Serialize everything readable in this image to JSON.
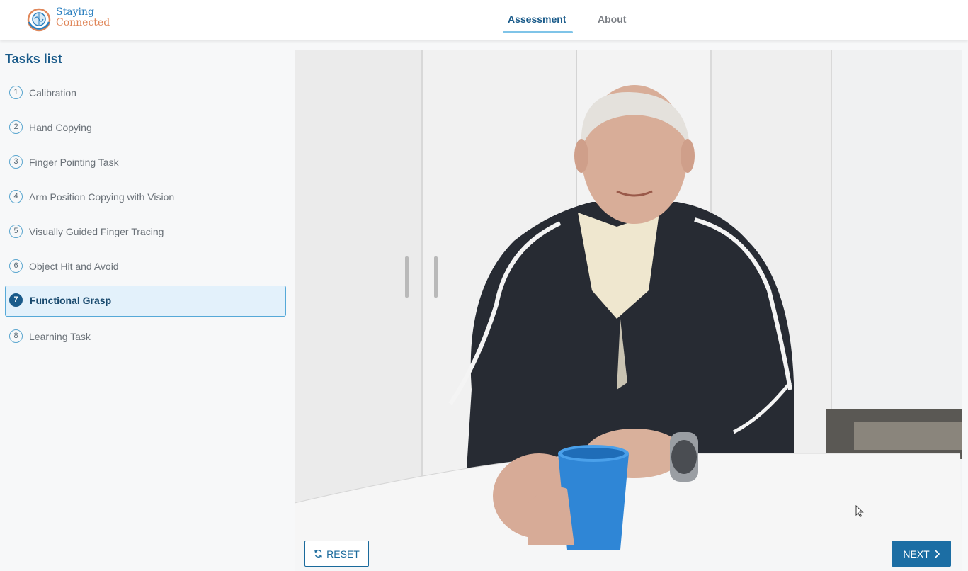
{
  "header": {
    "logo": {
      "line1": "Staying",
      "line2": "Connected"
    },
    "nav": [
      {
        "label": "Assessment",
        "active": true
      },
      {
        "label": "About",
        "active": false
      }
    ]
  },
  "sidebar": {
    "title": "Tasks list",
    "tasks": [
      {
        "number": "1",
        "label": "Calibration",
        "active": false
      },
      {
        "number": "2",
        "label": "Hand Copying",
        "active": false
      },
      {
        "number": "3",
        "label": "Finger Pointing Task",
        "active": false
      },
      {
        "number": "4",
        "label": "Arm Position Copying with Vision",
        "active": false
      },
      {
        "number": "5",
        "label": "Visually Guided Finger Tracing",
        "active": false
      },
      {
        "number": "6",
        "label": "Object Hit and Avoid",
        "active": false
      },
      {
        "number": "7",
        "label": "Functional Grasp",
        "active": true
      },
      {
        "number": "8",
        "label": "Learning Task",
        "active": false
      }
    ]
  },
  "controls": {
    "reset_label": "RESET",
    "next_label": "NEXT",
    "reset_icon": "refresh-icon",
    "next_icon": "chevron-right-icon"
  },
  "colors": {
    "primary": "#1c6ea4",
    "accent": "#7fc4e8",
    "active_bg": "#e3f1fb",
    "cup": "#2f86d6"
  }
}
